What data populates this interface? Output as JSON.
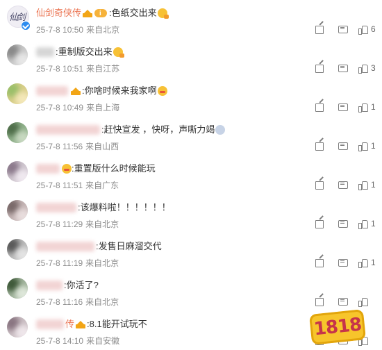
{
  "comments": [
    {
      "name": "仙剑奇侠传",
      "content": ":色纸交出来",
      "date": "25-7-8 10:50",
      "location": "来自北京",
      "likes": "6",
      "avatar_text": "仙剑"
    },
    {
      "name": "",
      "content": ":重制版交出来",
      "date": "25-7-8 10:51",
      "location": "来自江苏",
      "likes": "3"
    },
    {
      "name": "",
      "content": ":你啥时候来我家啊",
      "date": "25-7-8 10:49",
      "location": "来自上海",
      "likes": "1"
    },
    {
      "name": "",
      "content": ":赶快宣发 ，快呀，声嘶力竭",
      "date": "25-7-8 11:56",
      "location": "来自山西",
      "likes": "1"
    },
    {
      "name": "",
      "content": ":重置版什么时候能玩",
      "date": "25-7-8 11:51",
      "location": "来自广东",
      "likes": "1"
    },
    {
      "name": "",
      "content": ":该爆料啦！！！！！！",
      "date": "25-7-8 11:29",
      "location": "来自北京",
      "likes": "1"
    },
    {
      "name": "",
      "content": ":发售日麻溜交代",
      "date": "25-7-8 11:19",
      "location": "来自北京",
      "likes": "1"
    },
    {
      "name": "",
      "content": ":你活了?",
      "date": "25-7-8 11:16",
      "location": "来自北京",
      "likes": ""
    },
    {
      "name": "传",
      "content": ":8.1能开试玩不",
      "date": "25-7-8 14:10",
      "location": "来自安徽",
      "likes": ""
    }
  ],
  "watermark": {
    "text": "1818"
  },
  "colors": {
    "name": "#eb7350",
    "meta": "#8c8c8c",
    "icon": "#7d7d7d",
    "logo_bg": "#f7c52b",
    "logo_text": "#c6344a"
  }
}
